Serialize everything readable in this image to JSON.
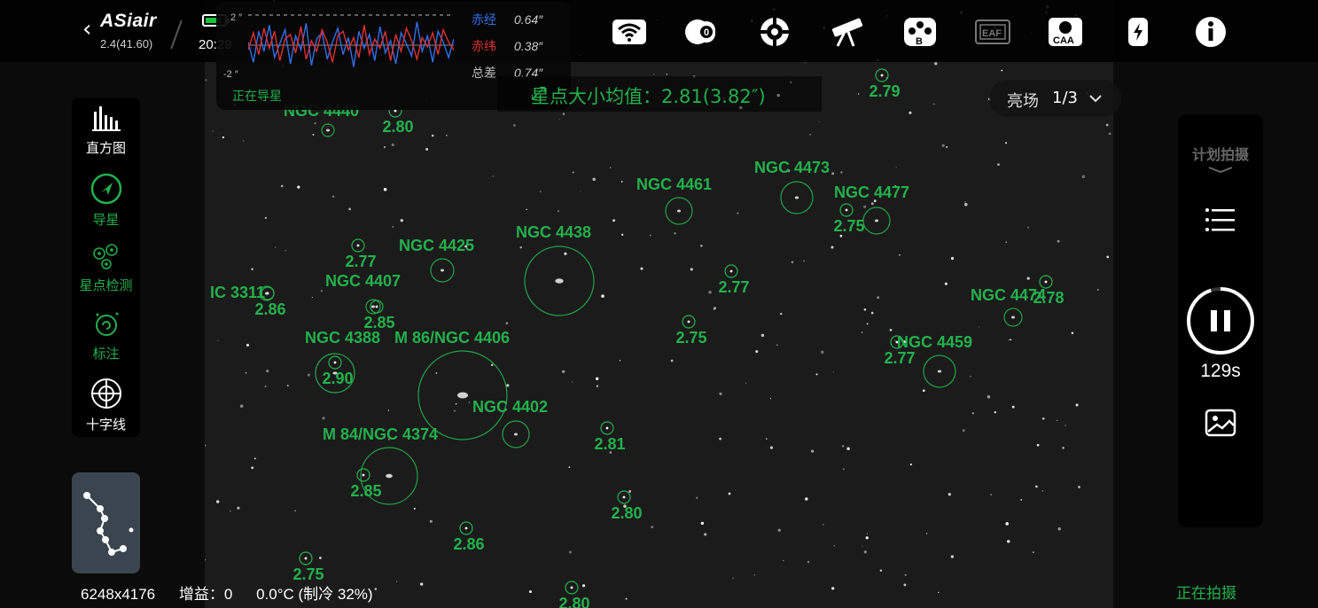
{
  "header": {
    "logo": "ASiair",
    "version": "2.4(41.60)",
    "time": "20:29",
    "battery_color": "#19c13c",
    "icons": [
      "wifi-icon",
      "camera-icon",
      "mount-icon",
      "telescope-icon",
      "filter-wheel-icon",
      "eaf-icon",
      "caa-icon",
      "usb-power-icon",
      "info-icon"
    ],
    "eaf_label": "EAF",
    "caa_label": "CAA",
    "filter_label": "B"
  },
  "guide": {
    "y_top": "2 ″",
    "y_bottom": "-2 ″",
    "ra_label": "赤经",
    "ra_value": "0.64″",
    "dec_label": "赤纬",
    "dec_value": "0.38″",
    "total_label": "总差",
    "total_value": "0.74″",
    "status": "正在导星",
    "ra_color": "#2f6fe8",
    "dec_color": "#e03030",
    "ra_series": [
      0.2,
      -1.1,
      0.9,
      -0.4,
      1.3,
      -0.8,
      0.1,
      1.0,
      -1.2,
      0.6,
      -0.3,
      1.4,
      -1.3,
      0.4,
      0.8,
      -0.9,
      0.2,
      1.1,
      -0.6,
      0.5,
      -1.4,
      0.9,
      -0.2,
      0.7,
      -1.0,
      1.2,
      -0.5,
      0.3,
      -1.2,
      0.8,
      0.1,
      -0.7,
      1.5,
      -0.4,
      0.6,
      -1.1,
      0.9,
      0.2,
      -0.8,
      0.4
    ],
    "dec_series": [
      -0.3,
      0.8,
      -0.6,
      1.1,
      -0.2,
      0.9,
      -1.0,
      0.4,
      0.7,
      -0.5,
      1.2,
      -0.9,
      0.3,
      -0.4,
      1.0,
      0.2,
      -1.1,
      0.6,
      0.9,
      -0.3,
      0.5,
      -0.8,
      1.3,
      -0.6,
      0.4,
      -0.2,
      0.9,
      -1.0,
      0.7,
      -0.4,
      1.1,
      0.3,
      -0.9,
      0.5,
      -0.1,
      0.8,
      -0.6,
      1.0,
      0.2,
      -0.3
    ]
  },
  "star_size": {
    "label": "星点大小均值：2.81(3.82″)"
  },
  "brightness": {
    "label": "亮场",
    "value": "1/3"
  },
  "left_tools": [
    {
      "label": "直方图",
      "icon": "histogram-icon",
      "color": "#ffffff"
    },
    {
      "label": "导星",
      "icon": "guide-icon",
      "color": "#22b14c"
    },
    {
      "label": "星点检测",
      "icon": "star-detect-icon",
      "color": "#22b14c"
    },
    {
      "label": "标注",
      "icon": "annotate-icon",
      "color": "#22b14c"
    },
    {
      "label": "十字线",
      "icon": "crosshair-icon",
      "color": "#ffffff"
    }
  ],
  "image_info": {
    "resolution": "6248x4176",
    "gain": "增益：0",
    "temp": "0.0°C (制冷 32%)"
  },
  "right_panel": {
    "plan_label": "计划拍摄",
    "countdown": "129s",
    "exposure_progress": 0.95
  },
  "status_text": "正在拍摄",
  "annotation_color": "#22b14c",
  "annotations": {
    "objects": [
      "NGC 4440",
      "NGC 4461",
      "NGC 4473",
      "NGC 4477",
      "NGC 4425",
      "NGC 4438",
      "NGC 4407",
      "IC 3311",
      "NGC 4388",
      "M 86/NGC 4406",
      "NGC 4402",
      "M 84/NGC 4374",
      "NGC 4459",
      "NGC 4474"
    ],
    "hfr": [
      "2.80",
      "2.79",
      "2.75",
      "2.77",
      "2.77",
      "2.86",
      "2.85",
      "2.75",
      "2.90",
      "2.77",
      "2.81",
      "2.85",
      "2.80",
      "2.86",
      "2.75",
      "2.80",
      "2.78"
    ]
  }
}
